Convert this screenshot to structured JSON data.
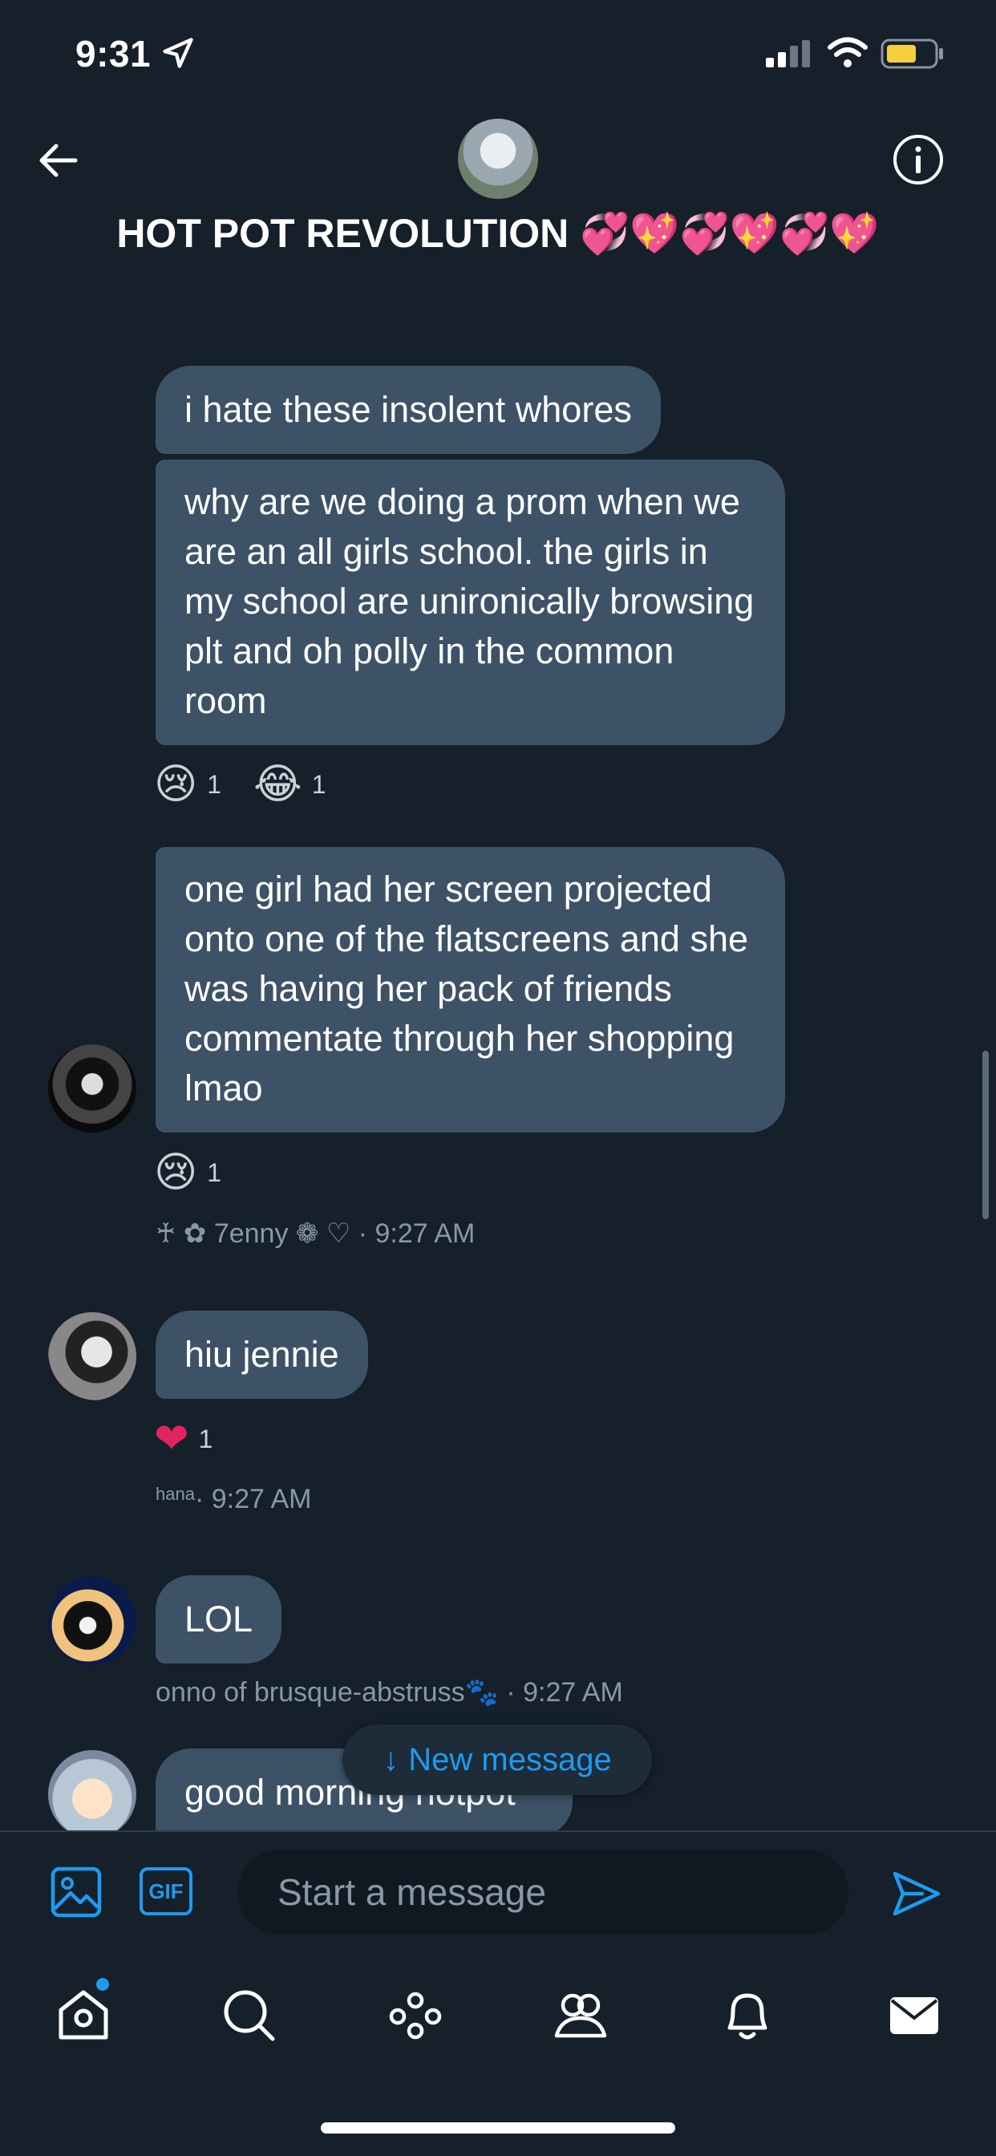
{
  "status_bar": {
    "time": "9:31"
  },
  "header": {
    "title": "HOT POT REVOLUTION 💞💖💞💖💞💖"
  },
  "messages": [
    {
      "text": "i hate these insolent whores"
    },
    {
      "text": "why are we doing a prom when we are an all girls school. the girls in my school are unironically browsing plt and oh polly in the common room"
    },
    {
      "text": "one girl had her screen projected onto one of the flatscreens and she was having her pack of friends commentate through her shopping lmao"
    },
    {
      "text": "hiu jennie"
    },
    {
      "text": "LOL"
    },
    {
      "text": "good morning hotpot"
    }
  ],
  "reactions": {
    "msg2_a": {
      "emoji": "😢",
      "count": "1"
    },
    "msg2_b": {
      "emoji": "😂",
      "count": "1"
    },
    "msg3": {
      "emoji": "😢",
      "count": "1"
    },
    "msg4": {
      "emoji": "❤",
      "count": "1"
    }
  },
  "meta": {
    "msg3": "♰ ✿ 7enny ❁ ♡ · 9:27 AM",
    "msg4_name": "hana",
    "msg4_time": " · 9:27 AM",
    "msg5": "onno of brusque-abstruss🐾 · 9:27 AM"
  },
  "new_message_pill": {
    "arrow": "↓",
    "label": "New message"
  },
  "composer": {
    "gif_label": "GIF",
    "placeholder": "Start a message"
  },
  "colors": {
    "background": "#15202b",
    "bubble": "#3d5266",
    "accent": "#1d9bf0",
    "muted": "#8899a6"
  },
  "icons": {
    "back": "back-arrow-icon",
    "info": "info-icon",
    "media": "image-icon",
    "send": "send-icon",
    "tabs": [
      "home-icon",
      "search-icon",
      "spaces-icon",
      "communities-icon",
      "bell-icon",
      "mail-icon"
    ]
  }
}
